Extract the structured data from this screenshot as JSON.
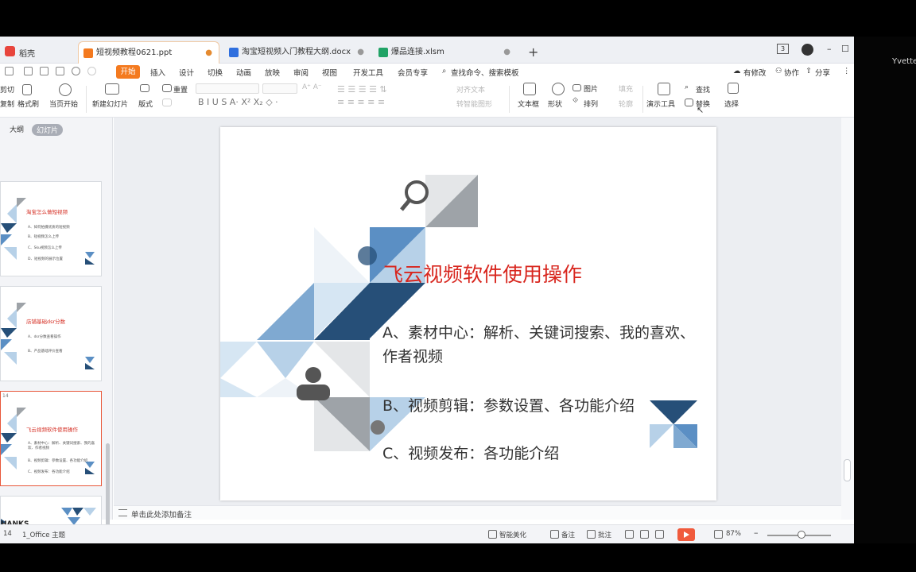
{
  "app": {
    "name": "稻壳",
    "right_user": "Yvette"
  },
  "tabs": [
    {
      "label": "短视频教程0621.ppt",
      "active": true,
      "color": "#f47a1f"
    },
    {
      "label": "淘宝短视频入门教程大纲.docx",
      "active": false,
      "color": "#2f6fde"
    },
    {
      "label": "爆品连接.xlsm",
      "active": false,
      "color": "#21a366"
    }
  ],
  "window": {
    "badge": "3"
  },
  "menu": {
    "items": [
      "开始",
      "插入",
      "设计",
      "切换",
      "动画",
      "放映",
      "审阅",
      "视图",
      "开发工具",
      "会员专享"
    ],
    "search": "查找命令、搜索模板",
    "right": [
      "有修改",
      "协作",
      "分享"
    ]
  },
  "ribbon": {
    "cut": "剪切",
    "copy": "复制",
    "format_painter": "格式刷",
    "from_current": "当页开始",
    "new_slide": "新建幻灯片",
    "layout": "版式",
    "reset": "重置",
    "text_box": "文本框",
    "shape": "形状",
    "picture": "图片",
    "arrange": "排列",
    "fill": "填充",
    "outline": "轮廓",
    "present_tools": "演示工具",
    "find": "查找",
    "replace": "替换",
    "select": "选择",
    "smart_shape": "转智能图形",
    "text_effect": "对齐文本"
  },
  "leftpanel": {
    "tab_outline": "大纲",
    "tab_slides": "幻灯片",
    "thumbs": [
      {
        "title": "淘宝怎么做短视频",
        "lines": [
          "A、如何拍摄优质的短视频",
          "B、短视频怎么上传",
          "C、Sku视频怎么上传",
          "D、短视频的展示位置"
        ]
      },
      {
        "title": "店铺基础dsr分数",
        "lines": [
          "A、dsr分数查看操作",
          "B、产品基础评价查看"
        ]
      },
      {
        "title": "飞云视频软件使用操作",
        "lines": [
          "A、素材中心：解析、关键词搜索、我的喜欢、作者视频",
          "B、视频剪辑：参数设置、各功能介绍",
          "C、视频发布：各功能介绍"
        ]
      },
      {
        "title": "HANKS",
        "lines": []
      }
    ]
  },
  "slide": {
    "title": "飞云视频软件使用操作",
    "items": [
      "A、素材中心：解析、关键词搜索、我的喜欢、作者视频",
      "B、视频剪辑：参数设置、各功能介绍",
      "C、视频发布：各功能介绍"
    ]
  },
  "notes": {
    "placeholder": "单击此处添加备注"
  },
  "status": {
    "slide_no": "14",
    "theme": "1_Office 主题",
    "beautify": "智能美化",
    "notes": "备注",
    "comment": "批注",
    "zoom": "87%"
  },
  "colors": {
    "accent": "#f47a1f",
    "title_red": "#d8261e",
    "navy": "#264f78",
    "mid_blue": "#5b8fc4",
    "light_blue": "#b7d1e8",
    "grey": "#9ea3a8"
  }
}
